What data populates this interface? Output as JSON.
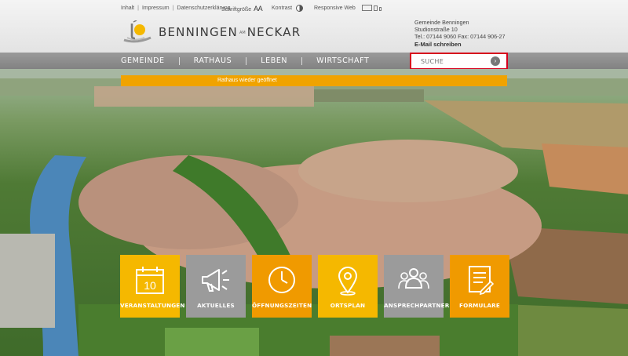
{
  "header": {
    "links": [
      "Inhalt",
      "Impressum",
      "Datenschutzerklärung"
    ],
    "separator": "|",
    "font_size_label": "Schriftgröße",
    "font_size_icon": "AA",
    "contrast_label": "Kontrast",
    "responsive_label": "Responsive Web",
    "logo": {
      "part1": "BENNINGEN",
      "small": "AM",
      "part2": "NECKAR"
    },
    "address": {
      "name": "Gemeinde Benningen",
      "street": "Studionstraße 10",
      "phone": "Tel.: 07144 9060 Fax: 07144 906-27",
      "email_link": "E-Mail schreiben"
    }
  },
  "nav": {
    "items": [
      "GEMEINDE",
      "RATHAUS",
      "LEBEN",
      "WIRTSCHAFT"
    ]
  },
  "search": {
    "placeholder": "SUCHE",
    "button_icon": "chevron-right-icon"
  },
  "notice": {
    "text": "Rathaus wieder geöffnet"
  },
  "tiles": [
    {
      "label": "VERANSTALTUNGEN",
      "icon": "calendar-icon",
      "color": "#f5b800",
      "calendar_day": "10"
    },
    {
      "label": "AKTUELLES",
      "icon": "megaphone-icon",
      "color": "#9b9b9b"
    },
    {
      "label": "ÖFFNUNGSZEITEN",
      "icon": "clock-icon",
      "color": "#f09a00"
    },
    {
      "label": "ORTSPLAN",
      "icon": "map-pin-icon",
      "color": "#f5b800"
    },
    {
      "label": "ANSPRECHPARTNER",
      "icon": "people-icon",
      "color": "#9b9b9b"
    },
    {
      "label": "FORMULARE",
      "icon": "document-icon",
      "color": "#f09a00"
    }
  ],
  "colors": {
    "accent_orange": "#f0a300",
    "accent_yellow": "#f5b800",
    "search_border": "#d6001c",
    "nav_gray": "#8c8c8c"
  }
}
